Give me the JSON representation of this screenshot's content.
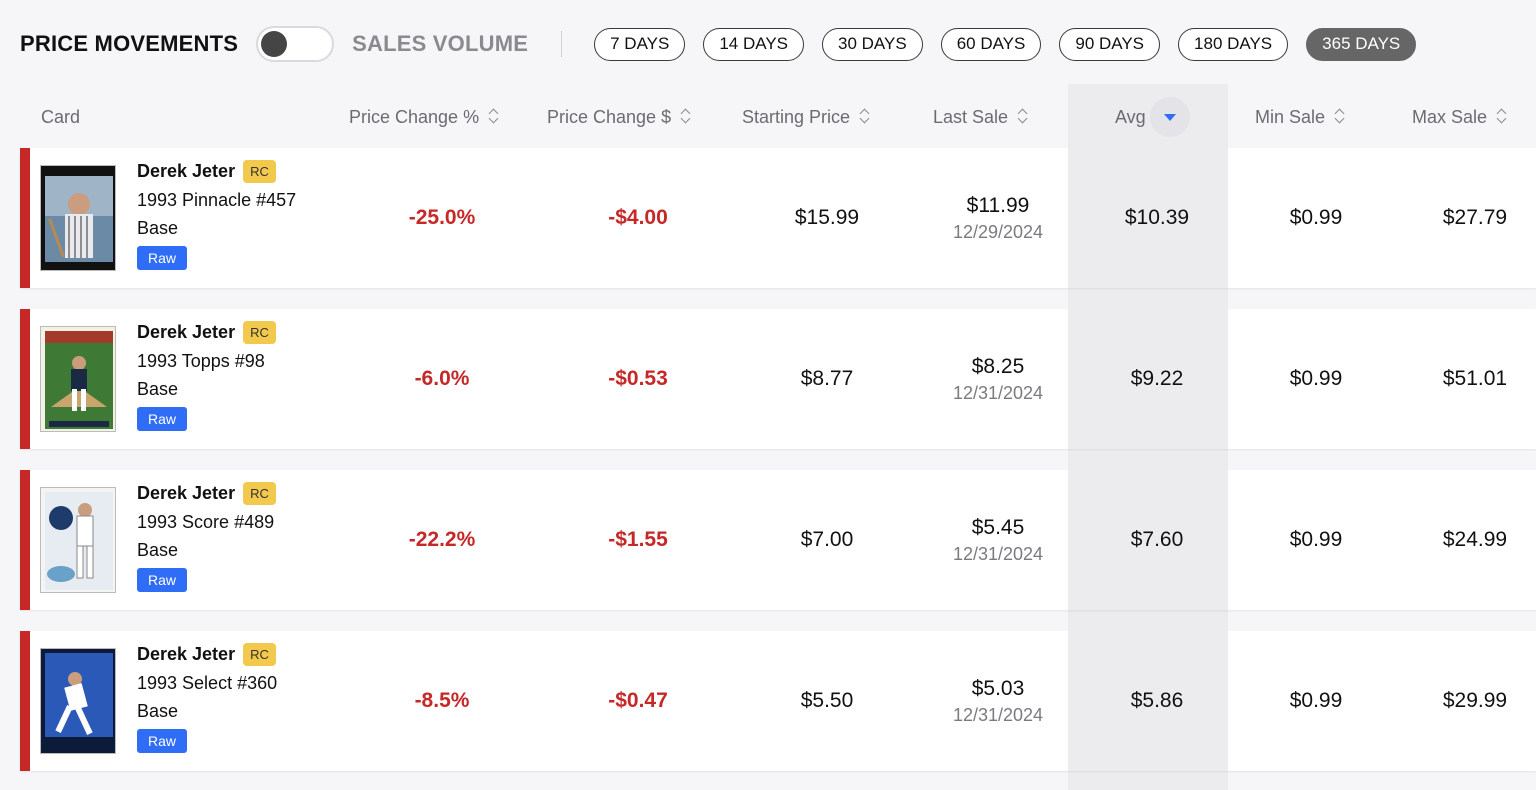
{
  "header": {
    "title": "PRICE MOVEMENTS",
    "toggle_alt": "SALES VOLUME",
    "periods": [
      {
        "label": "7 DAYS",
        "active": false
      },
      {
        "label": "14 DAYS",
        "active": false
      },
      {
        "label": "30 DAYS",
        "active": false
      },
      {
        "label": "60 DAYS",
        "active": false
      },
      {
        "label": "90 DAYS",
        "active": false
      },
      {
        "label": "180 DAYS",
        "active": false
      },
      {
        "label": "365 DAYS",
        "active": true
      }
    ]
  },
  "columns": {
    "card": "Card",
    "pct": "Price Change %",
    "usd": "Price Change $",
    "start": "Starting Price",
    "last": "Last Sale",
    "avg": "Avg",
    "min": "Min Sale",
    "max": "Max Sale"
  },
  "colors": {
    "negative": "#c62828",
    "accent": "#2f6df6",
    "rc_badge": "#f2c94c"
  },
  "rows": [
    {
      "player": "Derek Jeter",
      "badge": "RC",
      "set": "1993 Pinnacle #457",
      "variant": "Base",
      "grade": "Raw",
      "thumb_icon": "card-thumbnail",
      "pct": "-25.0%",
      "usd": "-$4.00",
      "start": "$15.99",
      "last": "$11.99",
      "last_date": "12/29/2024",
      "avg": "$10.39",
      "min": "$0.99",
      "max": "$27.79"
    },
    {
      "player": "Derek Jeter",
      "badge": "RC",
      "set": "1993 Topps #98",
      "variant": "Base",
      "grade": "Raw",
      "thumb_icon": "card-thumbnail",
      "pct": "-6.0%",
      "usd": "-$0.53",
      "start": "$8.77",
      "last": "$8.25",
      "last_date": "12/31/2024",
      "avg": "$9.22",
      "min": "$0.99",
      "max": "$51.01"
    },
    {
      "player": "Derek Jeter",
      "badge": "RC",
      "set": "1993 Score #489",
      "variant": "Base",
      "grade": "Raw",
      "thumb_icon": "card-thumbnail",
      "pct": "-22.2%",
      "usd": "-$1.55",
      "start": "$7.00",
      "last": "$5.45",
      "last_date": "12/31/2024",
      "avg": "$7.60",
      "min": "$0.99",
      "max": "$24.99"
    },
    {
      "player": "Derek Jeter",
      "badge": "RC",
      "set": "1993 Select #360",
      "variant": "Base",
      "grade": "Raw",
      "thumb_icon": "card-thumbnail",
      "pct": "-8.5%",
      "usd": "-$0.47",
      "start": "$5.50",
      "last": "$5.03",
      "last_date": "12/31/2024",
      "avg": "$5.86",
      "min": "$0.99",
      "max": "$29.99"
    }
  ]
}
